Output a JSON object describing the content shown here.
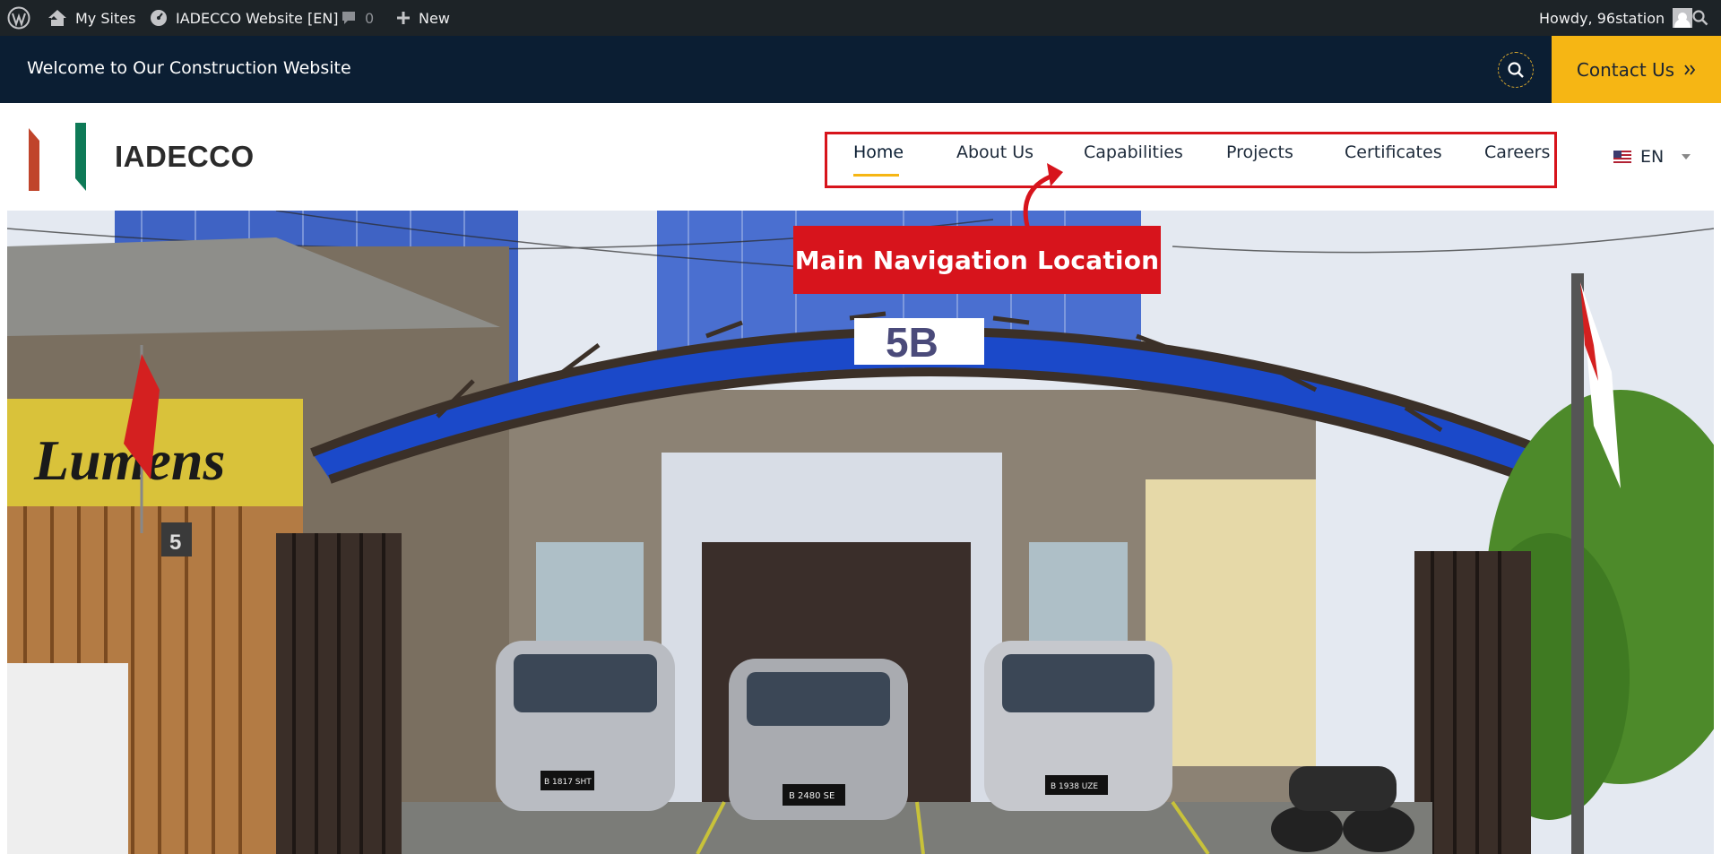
{
  "admin_bar": {
    "my_sites": "My Sites",
    "site_name": "IADECCO Website [EN]",
    "comments_count": "0",
    "new_label": "New",
    "howdy": "Howdy, 96station"
  },
  "top_bar": {
    "welcome": "Welcome to Our Construction Website",
    "contact_label": "Contact Us",
    "contact_icon": "double-chevron-right"
  },
  "header": {
    "logo_text": "IADECCO",
    "nav": [
      {
        "label": "Home",
        "active": true
      },
      {
        "label": "About Us"
      },
      {
        "label": "Capabilities"
      },
      {
        "label": "Projects"
      },
      {
        "label": "Certificates"
      },
      {
        "label": "Careers"
      }
    ],
    "language": "EN"
  },
  "annotation": {
    "callout": "Main Navigation Location"
  },
  "hero": {
    "building_sign": "5B",
    "shop_sign": "Lumens",
    "house_number": "5",
    "plates": [
      "B 1817 SHT",
      "B 2480 SE",
      "B 1938 UZE"
    ]
  },
  "colors": {
    "admin_bar": "#1d2327",
    "top_bar": "#0b1e33",
    "accent_yellow": "#f6b614",
    "annotation_red": "#d7141c",
    "logo_red": "#c0442b",
    "logo_green": "#0e7a57"
  }
}
